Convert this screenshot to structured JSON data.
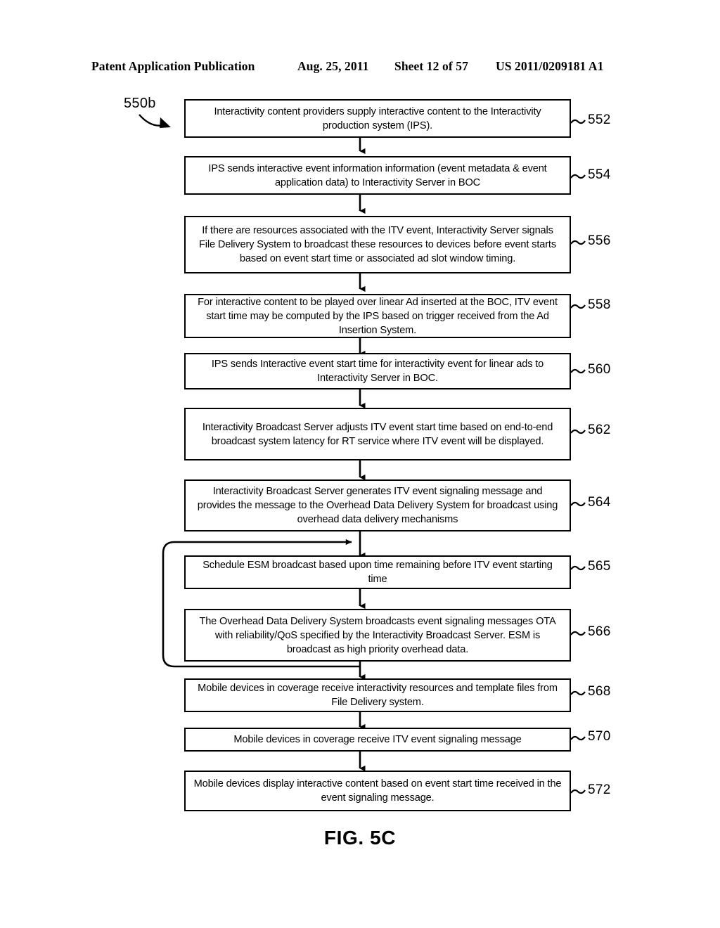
{
  "header": {
    "publication": "Patent Application Publication",
    "date": "Aug. 25, 2011",
    "sheet": "Sheet 12 of 57",
    "patent_number": "US 2011/0209181 A1"
  },
  "figure": {
    "diagram_label": "550b",
    "caption": "FIG. 5C",
    "steps": [
      {
        "ref": "552",
        "text": "Interactivity content providers supply interactive content to the Interactivity production system (IPS)."
      },
      {
        "ref": "554",
        "text": "IPS sends interactive event information information (event metadata & event application data) to Interactivity Server in BOC"
      },
      {
        "ref": "556",
        "text": "If there are resources associated with the ITV event, Interactivity Server signals File Delivery System to broadcast these resources to devices before event starts based on event start time or associated ad slot window timing."
      },
      {
        "ref": "558",
        "text": "For interactive content to be played over linear Ad inserted at the BOC, ITV event start time may be computed by the IPS based on trigger received from the Ad Insertion System."
      },
      {
        "ref": "560",
        "text": "IPS sends Interactive event start time for interactivity event for linear ads to Interactivity Server in BOC."
      },
      {
        "ref": "562",
        "text": "Interactivity Broadcast Server adjusts ITV event start time based on end-to-end broadcast system latency for RT service where ITV event will be displayed."
      },
      {
        "ref": "564",
        "text": "Interactivity Broadcast Server generates ITV event signaling message and provides the message to the Overhead Data Delivery System for broadcast using overhead data delivery mechanisms"
      },
      {
        "ref": "565",
        "text": "Schedule ESM broadcast based upon time remaining before ITV event starting time"
      },
      {
        "ref": "566",
        "text": "The Overhead Data Delivery System broadcasts event signaling messages OTA with reliability/QoS specified by the Interactivity Broadcast Server. ESM is broadcast as high priority overhead data."
      },
      {
        "ref": "568",
        "text": "Mobile devices in coverage receive interactivity resources and template files from File Delivery system."
      },
      {
        "ref": "570",
        "text": "Mobile devices in coverage receive ITV event signaling message"
      },
      {
        "ref": "572",
        "text": "Mobile devices display interactive content based on event start time received in the event signaling message."
      }
    ]
  }
}
